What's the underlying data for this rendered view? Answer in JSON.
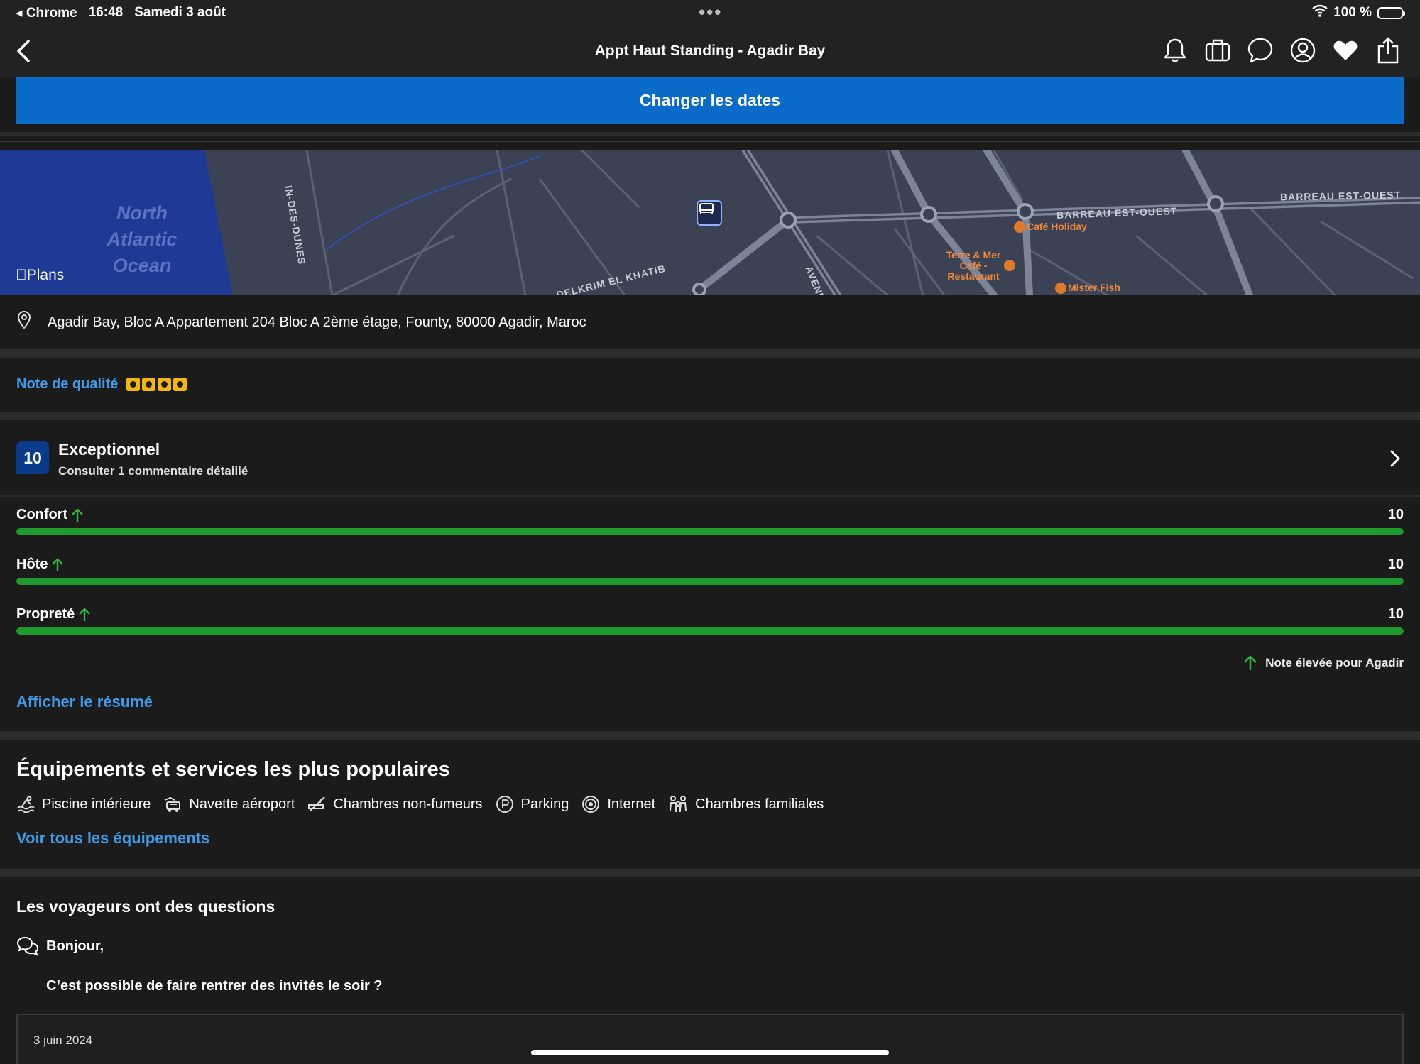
{
  "status_bar": {
    "back_app": "◂ Chrome",
    "time": "16:48",
    "date": "Samedi 3 août",
    "dots": "•••",
    "battery": "100 %"
  },
  "nav": {
    "title": "Appt Haut Standing - Agadir Bay",
    "icons": [
      "bell-icon",
      "suitcase-icon",
      "chat-bubble-icon",
      "account-icon",
      "heart-icon",
      "share-icon"
    ]
  },
  "dates_button": "Changer les dates",
  "map": {
    "ocean": [
      "North",
      "Atlantic",
      "Ocean"
    ],
    "logo": "Plans",
    "streets": [
      "IN-DES-DUNES",
      "BARREAU EST-OUEST",
      "BARREAU EST-OUEST",
      "DELKRIM EL KHATIB",
      "AVENU"
    ],
    "pois": [
      "Café Holiday",
      "Terre & Mer Café - Restaurant",
      "Mister Fish"
    ]
  },
  "address": "Agadir Bay, Bloc A Appartement 204 Bloc A 2ème étage, Founty, 80000 Agadir, Maroc",
  "quality": {
    "label": "Note de qualité",
    "stars": 4
  },
  "review": {
    "score": "10",
    "rating_label": "Exceptionnel",
    "sub_label": "Consulter 1 commentaire détaillé",
    "categories": [
      {
        "name": "Confort",
        "value": "10",
        "fraction": 1.0
      },
      {
        "name": "Hôte",
        "value": "10",
        "fraction": 1.0
      },
      {
        "name": "Propreté",
        "value": "10",
        "fraction": 1.0
      }
    ],
    "high_note": "Note élevée pour Agadir",
    "summary_link": "Afficher le résumé"
  },
  "amenities": {
    "title": "Équipements et services les plus populaires",
    "items": [
      {
        "label": "Piscine intérieure",
        "icon": "pool-icon"
      },
      {
        "label": "Navette aéroport",
        "icon": "shuttle-icon"
      },
      {
        "label": "Chambres non-fumeurs",
        "icon": "no-smoking-icon"
      },
      {
        "label": "Parking",
        "icon": "parking-icon"
      },
      {
        "label": "Internet",
        "icon": "wifi-icon"
      },
      {
        "label": "Chambres familiales",
        "icon": "family-icon"
      }
    ],
    "all_link": "Voir tous les équipements"
  },
  "questions": {
    "title": "Les voyageurs ont des questions",
    "greeting": "Bonjour,",
    "question": "C’est possible de faire rentrer des invités le soir ?",
    "answer_date": "3 juin 2024"
  },
  "colors": {
    "accent": "#0a6bc9",
    "link": "#3f9be8",
    "bar_green": "#1f9a2e",
    "star_yellow": "#f1b70f",
    "score_blue": "#0a3a8a"
  }
}
